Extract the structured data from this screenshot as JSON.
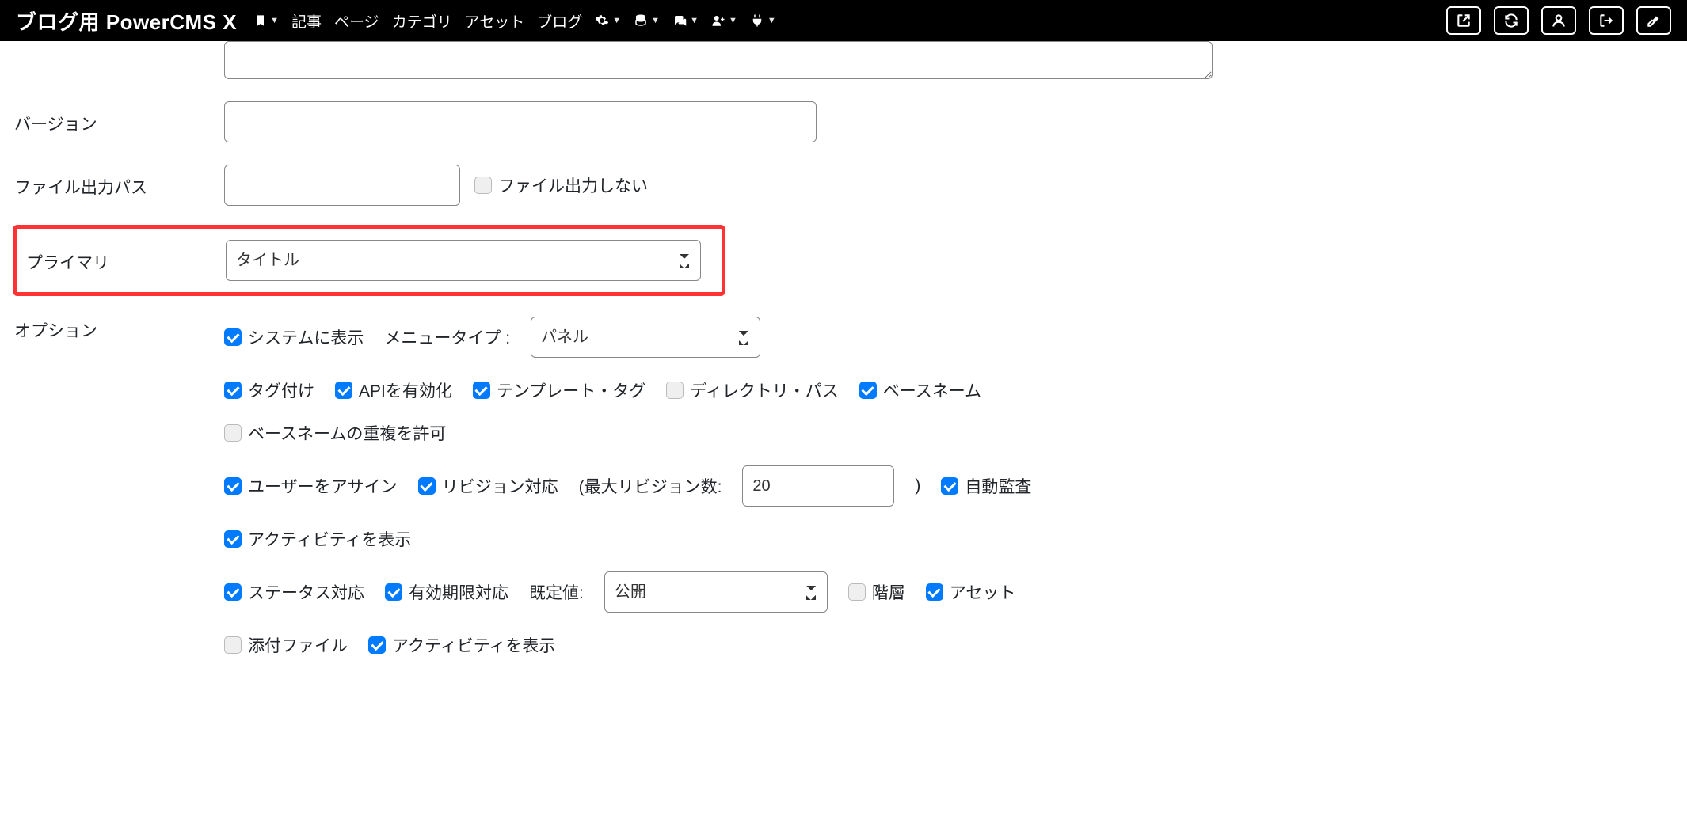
{
  "navbar": {
    "brand": "ブログ用 PowerCMS X",
    "items": {
      "articles": "記事",
      "pages": "ページ",
      "categories": "カテゴリ",
      "assets": "アセット",
      "blog": "ブログ"
    }
  },
  "form": {
    "version_label": "バージョン",
    "version_value": "",
    "filepath_label": "ファイル出力パス",
    "filepath_value": "",
    "filepath_disable": "ファイル出力しない",
    "primary_label": "プライマリ",
    "primary_value": "タイトル",
    "options_label": "オプション",
    "menu_type_label": "メニュータイプ :",
    "menu_type_value": "パネル",
    "max_rev_label_open": "(最大リビジョン数:",
    "max_rev_value": "20",
    "max_rev_label_close": ")",
    "default_label": "既定値:",
    "default_value": "公開"
  },
  "options": {
    "system_display": "システムに表示",
    "tagging": "タグ付け",
    "api_enable": "APIを有効化",
    "template_tag": "テンプレート・タグ",
    "directory_path": "ディレクトリ・パス",
    "basename": "ベースネーム",
    "basename_dup": "ベースネームの重複を許可",
    "assign_user": "ユーザーをアサイン",
    "revision": "リビジョン対応",
    "auto_audit": "自動監査",
    "activity_show": "アクティビティを表示",
    "status": "ステータス対応",
    "expiry": "有効期限対応",
    "hierarchy": "階層",
    "asset": "アセット",
    "attachment": "添付ファイル",
    "activity_show2": "アクティビティを表示"
  }
}
